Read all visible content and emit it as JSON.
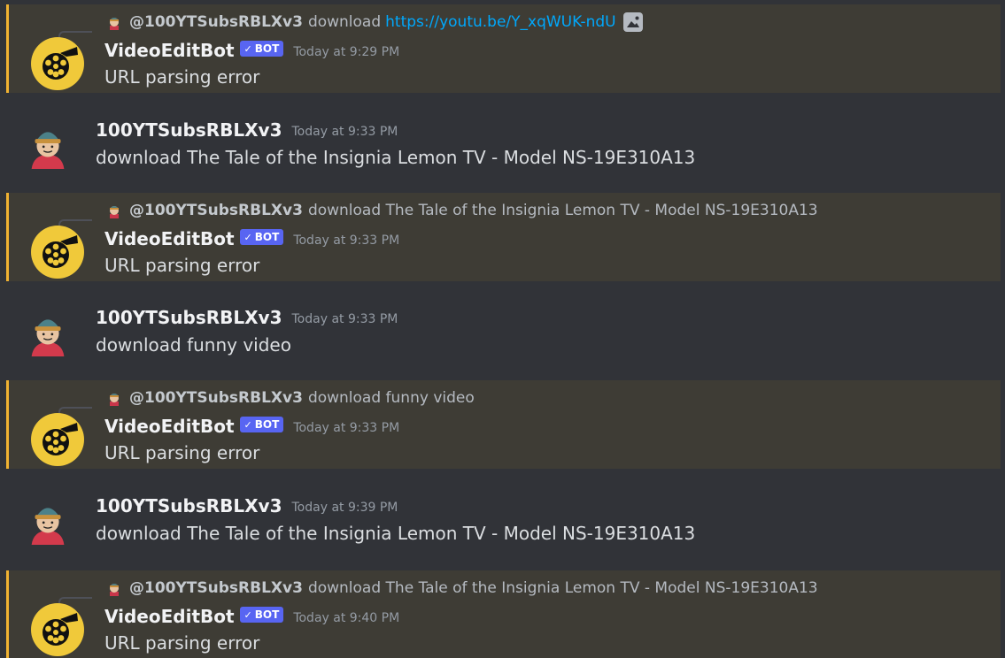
{
  "messages": [
    {
      "reply": {
        "author": "@100YTSubsRBLXv3",
        "text": "download",
        "link": "https://youtu.be/Y_xqWUK-ndU"
      },
      "username": "VideoEditBot",
      "tag": "BOT",
      "timestamp": "Today at 9:29 PM",
      "content": "URL parsing error"
    },
    {
      "username": "100YTSubsRBLXv3",
      "timestamp": "Today at 9:33 PM",
      "content": "download The Tale of the Insignia  Lemon TV - Model NS-19E310A13"
    },
    {
      "reply": {
        "author": "@100YTSubsRBLXv3",
        "text": "download The Tale of the Insignia Lemon TV - Model NS-19E310A13"
      },
      "username": "VideoEditBot",
      "tag": "BOT",
      "timestamp": "Today at 9:33 PM",
      "content": "URL parsing error"
    },
    {
      "username": "100YTSubsRBLXv3",
      "timestamp": "Today at 9:33 PM",
      "content": "download funny video"
    },
    {
      "reply": {
        "author": "@100YTSubsRBLXv3",
        "text": "download funny video"
      },
      "username": "VideoEditBot",
      "tag": "BOT",
      "timestamp": "Today at 9:33 PM",
      "content": "URL parsing error"
    },
    {
      "username": "100YTSubsRBLXv3",
      "timestamp": "Today at 9:39 PM",
      "content": "download The Tale of the Insignia  Lemon TV - Model NS-19E310A13"
    },
    {
      "reply": {
        "author": "@100YTSubsRBLXv3",
        "text": "download The Tale of the Insignia Lemon TV - Model NS-19E310A13"
      },
      "username": "VideoEditBot",
      "tag": "BOT",
      "timestamp": "Today at 9:40 PM",
      "content": "URL parsing error"
    }
  ],
  "icons": {
    "bot_avatar": "film-reel-icon",
    "user_avatar": "roblox-character-icon",
    "verified": "checkmark-icon",
    "image_attachment": "image-icon"
  },
  "colors": {
    "background": "#313338",
    "mention_background": "#3e3c35",
    "mention_bar": "#f0b232",
    "bot_tag": "#5865f2",
    "link": "#00a8fc",
    "bot_avatar": "#f0c93a"
  }
}
